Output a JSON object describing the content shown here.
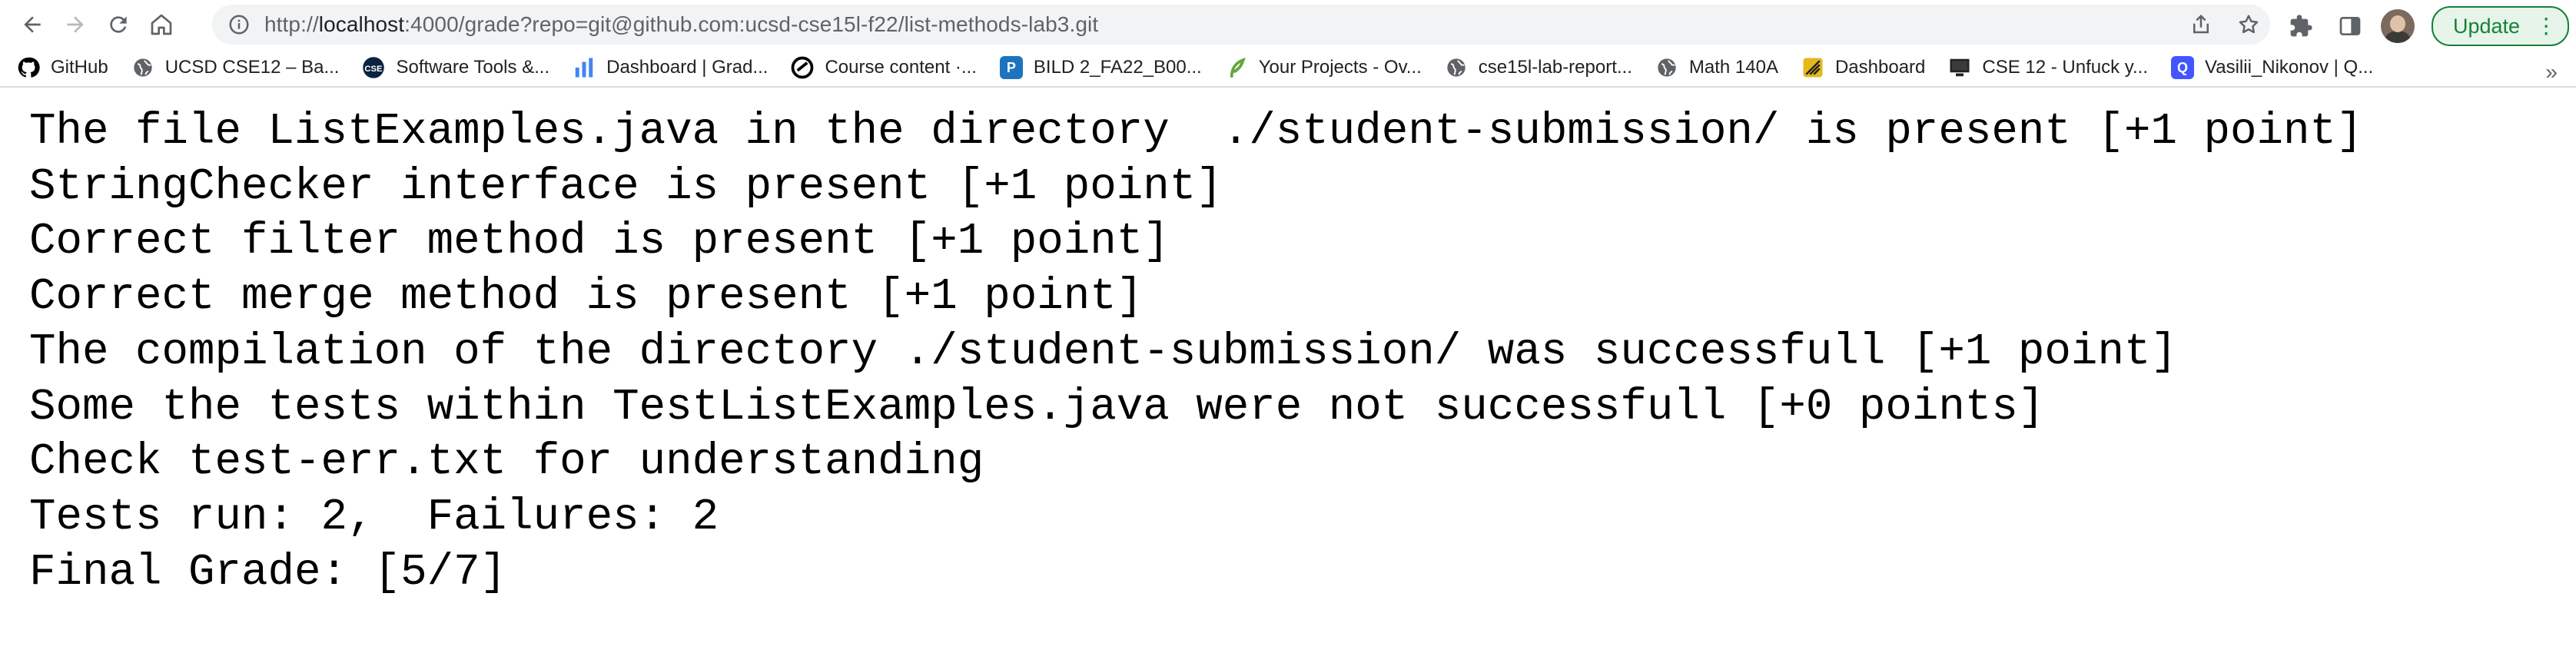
{
  "browser": {
    "url_prefix": "http://",
    "url_host": "localhost",
    "url_rest": ":4000/grade?repo=git@github.com:ucsd-cse15l-f22/list-methods-lab3.git",
    "update_label": "Update",
    "menu_glyph": "⋮"
  },
  "bookmarks": [
    {
      "label": "GitHub",
      "icon": "github-icon",
      "color": "#000000",
      "glyph": ""
    },
    {
      "label": "UCSD CSE12 – Ba...",
      "icon": "globe-icon",
      "color": "#5f6368",
      "glyph": ""
    },
    {
      "label": "Software Tools &...",
      "icon": "software-tools-icon",
      "color": "#0c2340",
      "glyph": ""
    },
    {
      "label": "Dashboard | Grad...",
      "icon": "bar-chart-icon",
      "color": "#4285f4",
      "glyph": ""
    },
    {
      "label": "Course content ·...",
      "icon": "course-icon",
      "color": "#000000",
      "glyph": ""
    },
    {
      "label": "BILD 2_FA22_B00...",
      "icon": "p-icon",
      "color": "#1e73be",
      "glyph": "P"
    },
    {
      "label": "Your Projects - Ov...",
      "icon": "leaf-icon",
      "color": "#62a83b",
      "glyph": ""
    },
    {
      "label": "cse15l-lab-report...",
      "icon": "globe-icon",
      "color": "#5f6368",
      "glyph": ""
    },
    {
      "label": "Math 140A",
      "icon": "globe-icon",
      "color": "#5f6368",
      "glyph": ""
    },
    {
      "label": "Dashboard",
      "icon": "canvas-dashboard-icon",
      "color": "#e5b91b",
      "glyph": ""
    },
    {
      "label": "CSE 12 - Unfuck y...",
      "icon": "monitor-icon",
      "color": "#222222",
      "glyph": ""
    },
    {
      "label": "Vasilii_Nikonov | Q...",
      "icon": "quizlet-icon",
      "color": "#4255ff",
      "glyph": "Q"
    }
  ],
  "bookmarks_more": "»",
  "content": {
    "lines": [
      "The file ListExamples.java in the directory  ./student-submission/ is present [+1 point]",
      "StringChecker interface is present [+1 point]",
      "Correct filter method is present [+1 point]",
      "Correct merge method is present [+1 point]",
      "The compilation of the directory ./student-submission/ was successfull [+1 point]",
      "Some the tests within TestListExamples.java were not successfull [+0 points]",
      "Check test-err.txt for understanding",
      "Tests run: 2,  Failures: 2",
      "Final Grade: [5/7]"
    ]
  }
}
